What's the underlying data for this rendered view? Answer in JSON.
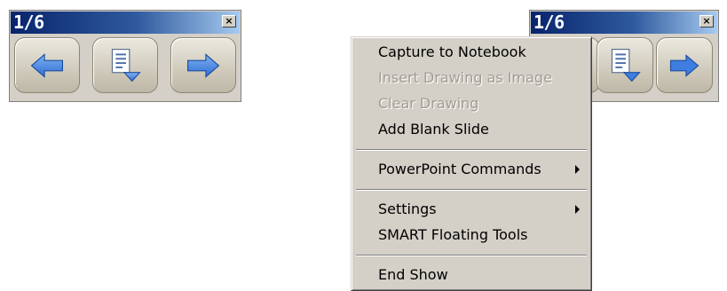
{
  "toolbar_left": {
    "page_indicator": "1/6",
    "close_glyph": "×",
    "buttons": [
      {
        "name": "previous-slide",
        "icon": "arrow-left-icon"
      },
      {
        "name": "slide-menu",
        "icon": "slide-down-icon"
      },
      {
        "name": "next-slide",
        "icon": "arrow-right-icon"
      }
    ]
  },
  "toolbar_right": {
    "page_indicator": "1/6",
    "close_glyph": "×"
  },
  "context_menu": {
    "items": [
      {
        "label": "Capture to Notebook",
        "enabled": true
      },
      {
        "label": "Insert Drawing as Image",
        "enabled": false
      },
      {
        "label": "Clear Drawing",
        "enabled": false
      },
      {
        "label": "Add Blank Slide",
        "enabled": true
      },
      {
        "label": "PowerPoint Commands",
        "enabled": true,
        "submenu": true
      },
      {
        "label": "Settings",
        "enabled": true,
        "submenu": true
      },
      {
        "label": "SMART Floating Tools",
        "enabled": true
      },
      {
        "label": "End Show",
        "enabled": true
      }
    ]
  },
  "colors": {
    "titlebar_start": "#08246b",
    "titlebar_end": "#a6caf0",
    "arrow_blue": "#3d7ee0",
    "menu_bg": "#d4d0c8",
    "disabled_text": "#a09c94"
  }
}
